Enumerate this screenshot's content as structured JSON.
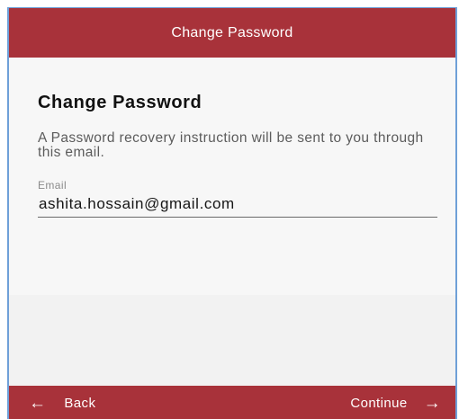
{
  "header": {
    "title": "Change Password"
  },
  "main": {
    "heading": "Change Password",
    "instruction": "A Password recovery instruction will be sent to you through this email.",
    "email_field": {
      "label": "Email",
      "value": "ashita.hossain@gmail.com"
    }
  },
  "footer": {
    "back_label": "Back",
    "back_icon": "arrow-left-icon",
    "continue_label": "Continue",
    "continue_icon": "arrow-right-icon"
  },
  "colors": {
    "accent": "#a8323a",
    "background": "#f5f5f5"
  }
}
